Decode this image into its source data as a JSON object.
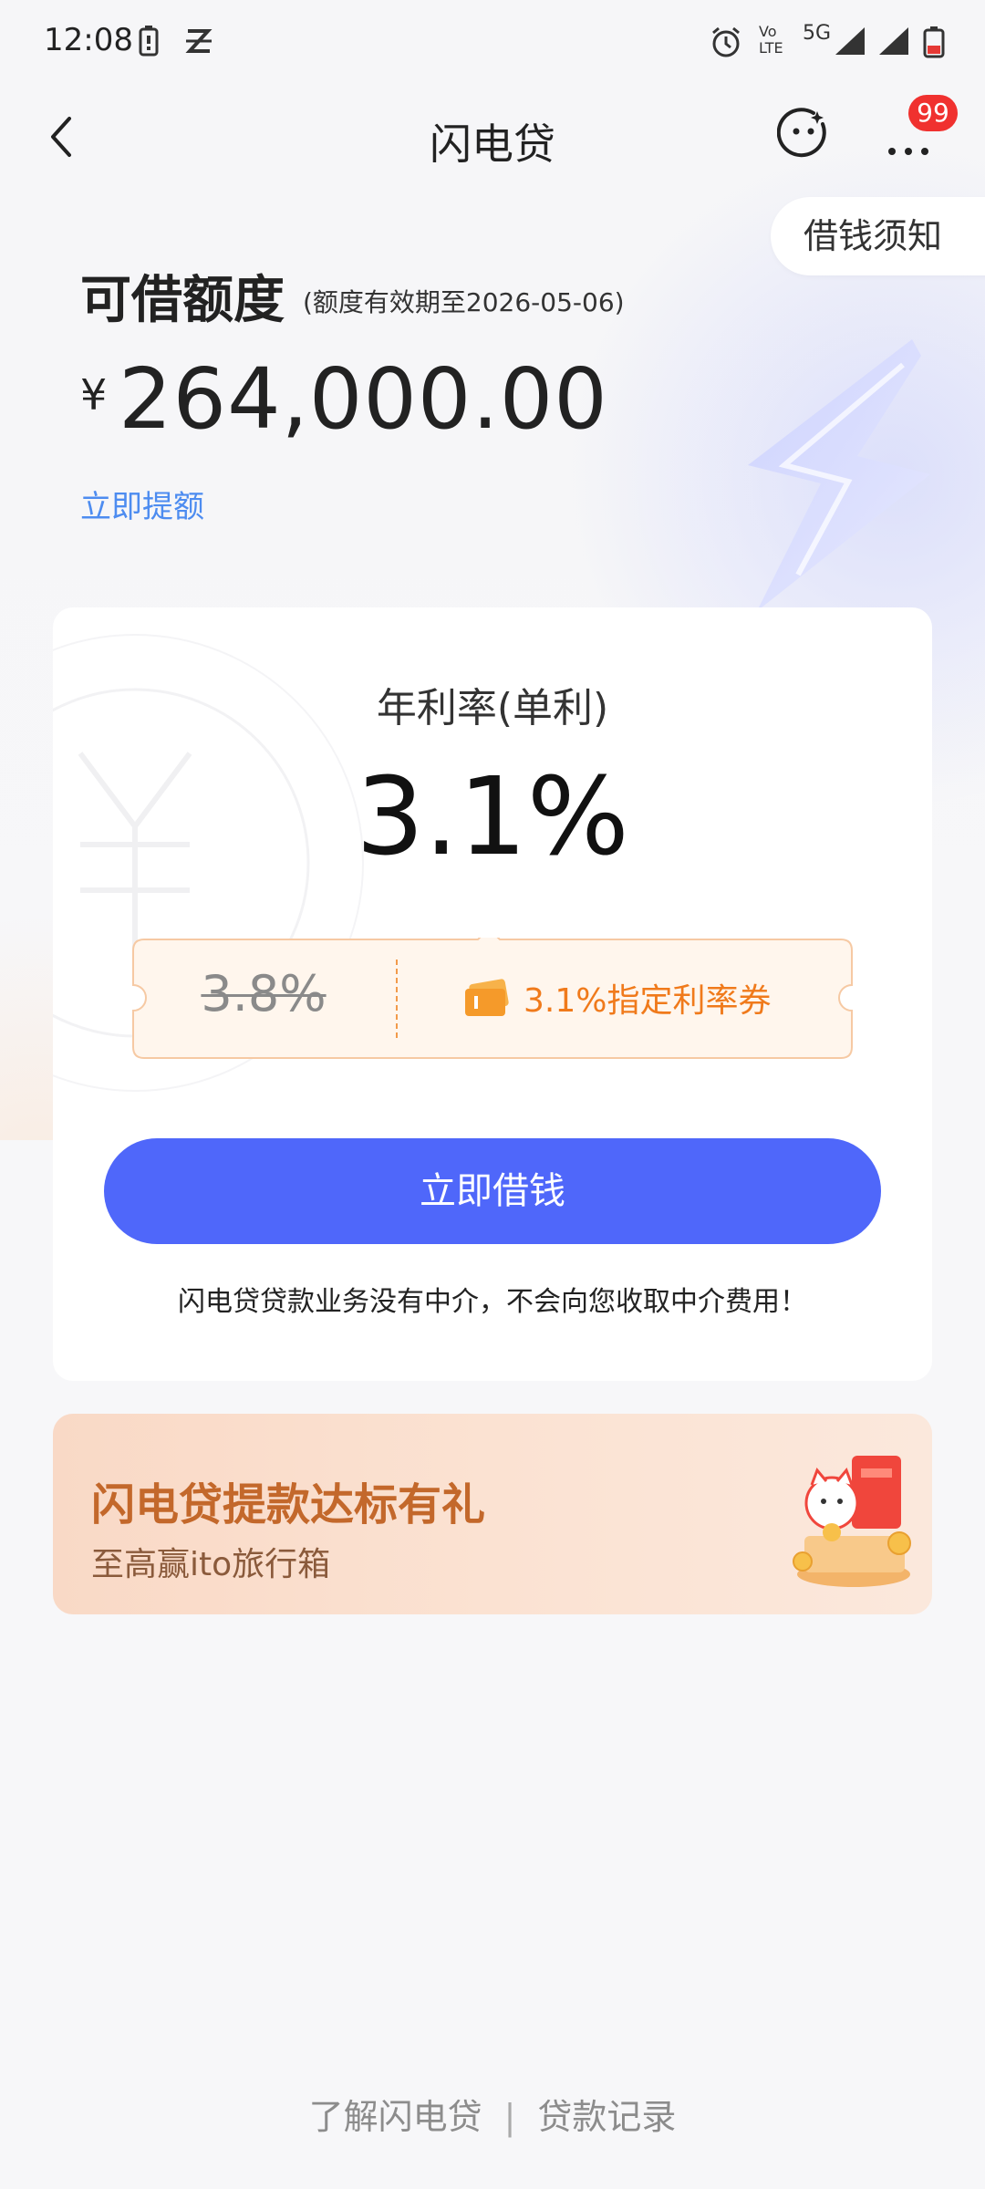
{
  "status_bar": {
    "time": "12:08",
    "network": "5G",
    "volte": "Vo LTE"
  },
  "nav": {
    "title": "闪电贷",
    "more_badge": "99"
  },
  "notice": {
    "label": "借钱须知"
  },
  "credit": {
    "title": "可借额度",
    "valid_until": "(额度有效期至2026-05-06)",
    "currency": "¥",
    "amount": "264,000.00",
    "raise_link": "立即提额"
  },
  "rate_card": {
    "label": "年利率(单利)",
    "value": "3.1%",
    "original_rate": "3.8%",
    "coupon_text": "3.1%指定利率券",
    "borrow_button": "立即借钱",
    "disclaimer": "闪电贷贷款业务没有中介，不会向您收取中介费用！"
  },
  "promo": {
    "title": "闪电贷提款达标有礼",
    "subtitle": "至高赢ito旅行箱"
  },
  "footer": {
    "learn_link": "了解闪电贷",
    "separator": "|",
    "records_link": "贷款记录"
  },
  "colors": {
    "primary": "#4f67fa",
    "link": "#4d8cf0",
    "coupon_orange": "#f07a1b",
    "badge_red": "#f0312f",
    "promo_title": "#c3682b"
  }
}
